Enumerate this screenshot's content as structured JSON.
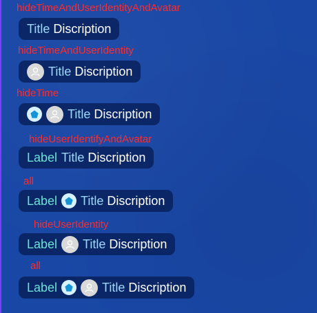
{
  "colors": {
    "background": "#1947a5",
    "section_label": "#ff2b2b",
    "pill_background": "#0b2463",
    "label_text": "#6fe0d6",
    "title_text": "#9fd8ff",
    "description_text": "#ffffff",
    "left_edge_line": "#7c3cff"
  },
  "sections": [
    {
      "heading": "hideTimeAndUserIdentityAndAvatar",
      "title": "Title",
      "description": "Discription"
    },
    {
      "heading": "hideTimeAndUserIdentity",
      "avatar_icon": "user-avatar-icon",
      "title": "Title",
      "description": "Discription"
    },
    {
      "heading": "hideTime",
      "badge_icon": "pentagon-badge-icon",
      "avatar_icon": "user-avatar-icon",
      "title": "Title",
      "description": "Discription"
    },
    {
      "heading": "hideUserIdentifyAndAvatar",
      "label": "Label",
      "title": "Title",
      "description": "Discription"
    },
    {
      "heading": "all",
      "label": "Label",
      "badge_icon": "pentagon-badge-icon",
      "title": "Title",
      "description": "Discription"
    },
    {
      "heading": "hideUserIdentity",
      "label": "Label",
      "avatar_icon": "user-avatar-icon",
      "title": "Title",
      "description": "Discription"
    },
    {
      "heading": "all",
      "label": "Label",
      "badge_icon": "pentagon-badge-icon",
      "avatar_icon": "user-avatar-icon",
      "title": "Title",
      "description": "Discription"
    }
  ]
}
